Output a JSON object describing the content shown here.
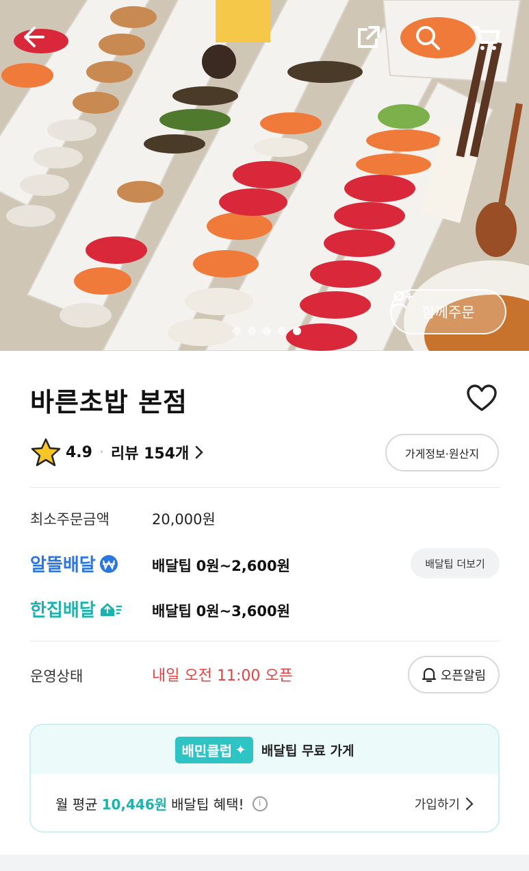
{
  "hero": {
    "image_alt": "sushi platters",
    "slides_total": 5,
    "active_slide": 5,
    "together_order_label": "함께주문",
    "icons": [
      "back-arrow-icon",
      "share-icon",
      "search-icon",
      "cart-icon",
      "person-add-icon"
    ]
  },
  "store": {
    "name": "바른초밥 본점",
    "rating": "4.9",
    "review_label": "리뷰 154개",
    "store_info_button": "가게정보·원산지"
  },
  "order_info": {
    "min_order_label": "최소주문금액",
    "min_order_value": "20,000원",
    "delivery_options": [
      {
        "brand": "알뜰배달",
        "tip_prefix": "배달팁",
        "tip_value": "0원~2,600원"
      },
      {
        "brand": "한집배달",
        "tip_prefix": "배달팁",
        "tip_value": "0원~3,600원"
      }
    ],
    "more_tips_button": "배달팁 더보기"
  },
  "operation": {
    "label": "운영상태",
    "status": "내일 오전 11:00 오픈",
    "alarm_button": "오픈알림"
  },
  "club": {
    "badge": "배민클럽",
    "headline": "배달팁 무료 가게",
    "benefit_prefix": "월 평균",
    "benefit_amount": "10,446원",
    "benefit_suffix": "배달팁 혜택!",
    "join_label": "가입하기"
  },
  "colors": {
    "accent_blue": "#2c76e0",
    "accent_teal": "#1bb3b0",
    "status_red": "#e84040"
  }
}
